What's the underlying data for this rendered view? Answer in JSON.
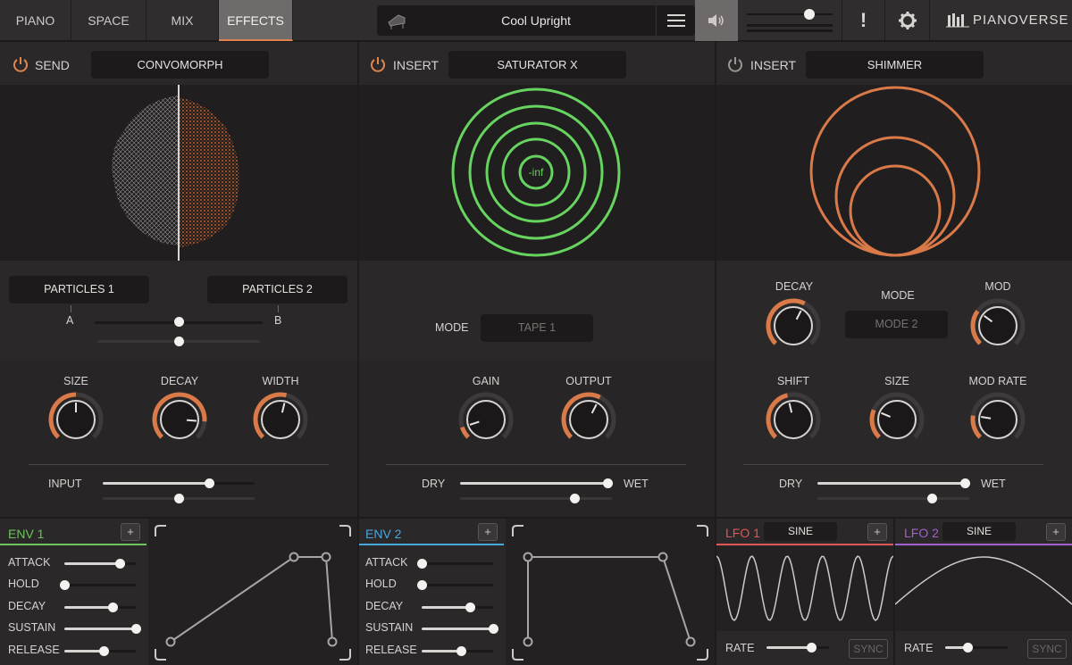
{
  "tabs": [
    {
      "label": "PIANO",
      "active": false
    },
    {
      "label": "SPACE",
      "active": false
    },
    {
      "label": "MIX",
      "active": false
    },
    {
      "label": "EFFECTS",
      "active": true
    }
  ],
  "preset": {
    "name": "Cool Upright"
  },
  "header_right": {
    "alert": "!",
    "brand": "PIANOVERSE",
    "volume_level": 0.73
  },
  "colors": {
    "accent": "#e0854f",
    "green": "#67d45f",
    "env1": "#6cc45c",
    "env2": "#4aa7e0",
    "lfo1": "#e05555",
    "lfo2": "#a060d0"
  },
  "send": {
    "label": "SEND",
    "effect": "CONVOMORPH",
    "particles_a": "PARTICLES 1",
    "particles_b": "PARTICLES 2",
    "a_label": "A",
    "b_label": "B",
    "morph": 0.5,
    "morph2": 0.5,
    "knobs": [
      {
        "label": "SIZE",
        "value": 0.5
      },
      {
        "label": "DECAY",
        "value": 0.85
      },
      {
        "label": "WIDTH",
        "value": 0.55
      }
    ],
    "input_label": "INPUT",
    "input": 0.7,
    "input2": 0.5
  },
  "insert1": {
    "label": "INSERT",
    "effect": "SATURATOR X",
    "readout": "-inf",
    "mode_label": "MODE",
    "mode_value": "TAPE 1",
    "knobs": [
      {
        "label": "GAIN",
        "value": 0.1
      },
      {
        "label": "OUTPUT",
        "value": 0.6
      }
    ],
    "dry_label": "DRY",
    "wet_label": "WET",
    "drywet": 1.0,
    "drywet2": 0.75
  },
  "insert2": {
    "label": "INSERT",
    "effect": "SHIMMER",
    "mode_label": "MODE",
    "mode_value": "MODE 2",
    "knobs_top": [
      {
        "label": "DECAY",
        "value": 0.6
      },
      {
        "label": "MOD",
        "value": 0.3
      }
    ],
    "knobs_bottom": [
      {
        "label": "SHIFT",
        "value": 0.45
      },
      {
        "label": "SIZE",
        "value": 0.25
      },
      {
        "label": "MOD RATE",
        "value": 0.2
      }
    ],
    "dry_label": "DRY",
    "wet_label": "WET",
    "drywet": 1.0,
    "drywet2": 0.75
  },
  "env1": {
    "title": "ENV 1",
    "params": [
      {
        "label": "ATTACK",
        "value": 0.78
      },
      {
        "label": "HOLD",
        "value": 0.0
      },
      {
        "label": "DECAY",
        "value": 0.68
      },
      {
        "label": "SUSTAIN",
        "value": 1.0
      },
      {
        "label": "RELEASE",
        "value": 0.55
      }
    ]
  },
  "env2": {
    "title": "ENV 2",
    "params": [
      {
        "label": "ATTACK",
        "value": 0.0
      },
      {
        "label": "HOLD",
        "value": 0.0
      },
      {
        "label": "DECAY",
        "value": 0.68
      },
      {
        "label": "SUSTAIN",
        "value": 1.0
      },
      {
        "label": "RELEASE",
        "value": 0.55
      }
    ]
  },
  "lfo1": {
    "title": "LFO 1",
    "shape": "SINE",
    "rate_label": "RATE",
    "rate": 0.72,
    "sync": "SYNC"
  },
  "lfo2": {
    "title": "LFO 2",
    "shape": "SINE",
    "rate_label": "RATE",
    "rate": 0.35,
    "sync": "SYNC"
  }
}
